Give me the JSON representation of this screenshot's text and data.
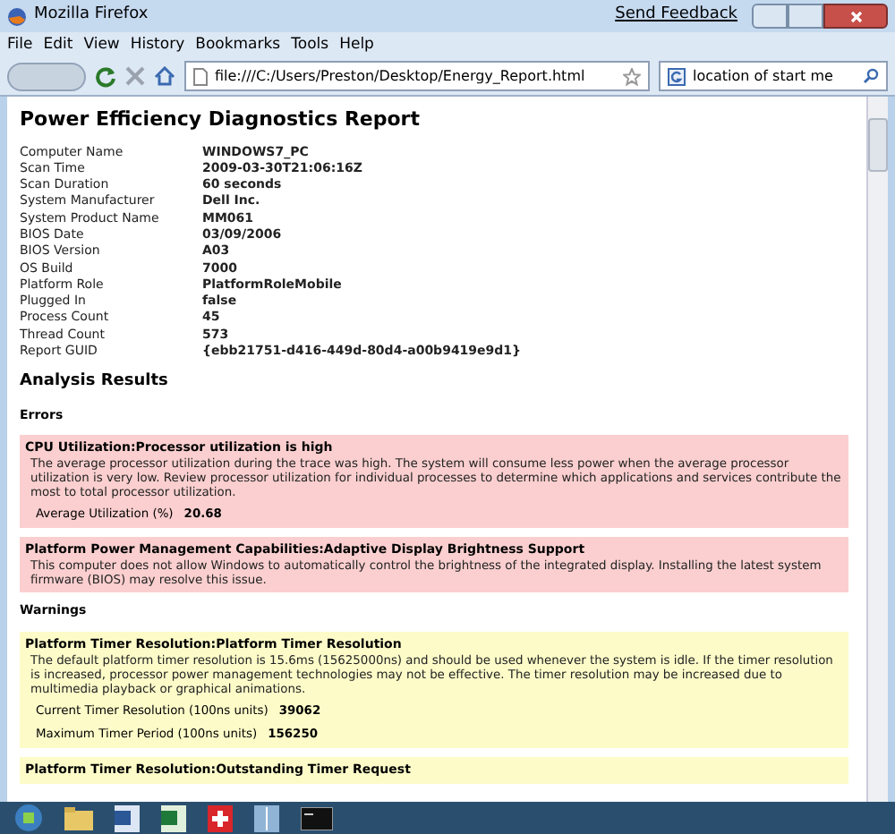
{
  "window": {
    "title": "Mozilla Firefox",
    "feedback_link": "Send Feedback"
  },
  "menu": [
    "File",
    "Edit",
    "View",
    "History",
    "Bookmarks",
    "Tools",
    "Help"
  ],
  "address": {
    "value": "file:///C:/Users/Preston/Desktop/Energy_Report.html"
  },
  "search": {
    "value": "location of start me"
  },
  "report": {
    "title": "Power Efficiency Diagnostics Report",
    "info": [
      {
        "label": "Computer Name",
        "value": "WINDOWS7_PC"
      },
      {
        "label": "Scan Time",
        "value": "2009-03-30T21:06:16Z"
      },
      {
        "label": "Scan Duration",
        "value": "60 seconds"
      },
      {
        "label": "System Manufacturer",
        "value": "Dell Inc."
      },
      {
        "label": "System Product Name",
        "value": "MM061"
      },
      {
        "label": "BIOS Date",
        "value": "03/09/2006"
      },
      {
        "label": "BIOS Version",
        "value": "A03"
      },
      {
        "label": "OS Build",
        "value": "7000"
      },
      {
        "label": "Platform Role",
        "value": "PlatformRoleMobile"
      },
      {
        "label": "Plugged In",
        "value": "false"
      },
      {
        "label": "Process Count",
        "value": "45"
      },
      {
        "label": "Thread Count",
        "value": "573"
      },
      {
        "label": "Report GUID",
        "value": "{ebb21751-d416-449d-80d4-a00b9419e9d1}"
      }
    ],
    "analysis_title": "Analysis Results",
    "sections": [
      {
        "heading": "Errors",
        "items": [
          {
            "kind": "error",
            "title": "CPU Utilization:Processor utilization is high",
            "description": "The average processor utilization during the trace was high. The system will consume less power when the average processor utilization is very low. Review processor utilization for individual processes to determine which applications and services contribute the most to total processor utilization.",
            "metrics": [
              {
                "label": "Average Utilization (%)",
                "value": "20.68"
              }
            ]
          },
          {
            "kind": "error",
            "title": "Platform Power Management Capabilities:Adaptive Display Brightness Support",
            "description": "This computer does not allow Windows to automatically control the brightness of the integrated display. Installing the latest system firmware (BIOS) may resolve this issue."
          }
        ]
      },
      {
        "heading": "Warnings",
        "items": [
          {
            "kind": "warning",
            "title": "Platform Timer Resolution:Platform Timer Resolution",
            "description": "The default platform timer resolution is 15.6ms (15625000ns) and should be used whenever the system is idle. If the timer resolution is increased, processor power management technologies may not be effective. The timer resolution may be increased due to multimedia playback or graphical animations.",
            "metrics": [
              {
                "label": "Current Timer Resolution (100ns units)",
                "value": "39062"
              },
              {
                "label": "Maximum Timer Period (100ns units)",
                "value": "156250"
              }
            ]
          },
          {
            "kind": "warning",
            "title": "Platform Timer Resolution:Outstanding Timer Request"
          }
        ]
      }
    ]
  }
}
